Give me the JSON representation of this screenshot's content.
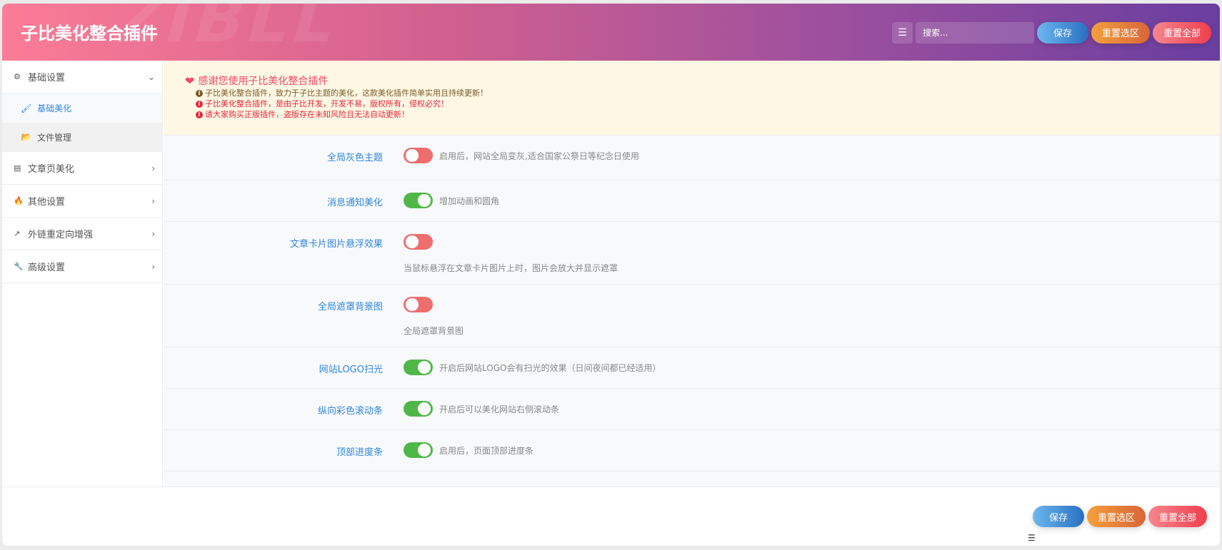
{
  "header": {
    "title": "子比美化整合插件",
    "watermark": "ZIBLL",
    "search_placeholder": "搜索...",
    "save": "保存",
    "reset_section": "重置选区",
    "reset_all": "重置全部"
  },
  "sidebar": {
    "items": [
      {
        "label": "基础设置",
        "icon": "gear-icon",
        "expanded": true,
        "children": [
          {
            "label": "基础美化",
            "icon": "brush-icon",
            "active": true
          },
          {
            "label": "文件管理",
            "icon": "folder-open-icon"
          }
        ]
      },
      {
        "label": "文章页美化",
        "icon": "file-text-icon"
      },
      {
        "label": "其他设置",
        "icon": "fire-icon"
      },
      {
        "label": "外链重定向增强",
        "icon": "external-link-icon"
      },
      {
        "label": "高级设置",
        "icon": "wrench-icon"
      }
    ]
  },
  "notice": {
    "title": "感谢您使用子比美化整合插件",
    "lines": [
      {
        "text": "子比美化整合插件，致力于子比主题的美化，这款美化插件简单实用且持续更新！",
        "color": "#7a5b2a"
      },
      {
        "text": "子比美化整合插件，是由子比开发，开发不易，版权所有，侵权必究！",
        "color": "#e8263e"
      },
      {
        "text": "请大家购买正版插件，盗版存在未知风险且无法自动更新！",
        "color": "#e8263e"
      }
    ]
  },
  "settings": [
    {
      "label": "全局灰色主题",
      "enabled": false,
      "desc": "启用后，网站全局变灰,适合国家公祭日等纪念日使用"
    },
    {
      "label": "消息通知美化",
      "enabled": true,
      "desc": "增加动画和圆角"
    },
    {
      "label": "文章卡片图片悬浮效果",
      "enabled": false,
      "desc": "当鼠标悬浮在文章卡片图片上时，图片会放大并显示遮罩"
    },
    {
      "label": "全局遮罩背景图",
      "enabled": false,
      "desc": "全局遮罩背景图"
    },
    {
      "label": "网站LOGO扫光",
      "enabled": true,
      "desc": "开启后网站LOGO会有扫光的效果（日间夜间都已经适用）"
    },
    {
      "label": "纵向彩色滚动条",
      "enabled": true,
      "desc": "开启后可以美化网站右侧滚动条"
    },
    {
      "label": "顶部进度条",
      "enabled": true,
      "desc": "启用后，页面顶部进度条"
    }
  ],
  "footer": {
    "save": "保存",
    "reset_section": "重置选区",
    "reset_all": "重置全部"
  },
  "colors": {
    "on": "#4fb748",
    "off": "#ee6d6d",
    "label": "#2f87dd"
  }
}
